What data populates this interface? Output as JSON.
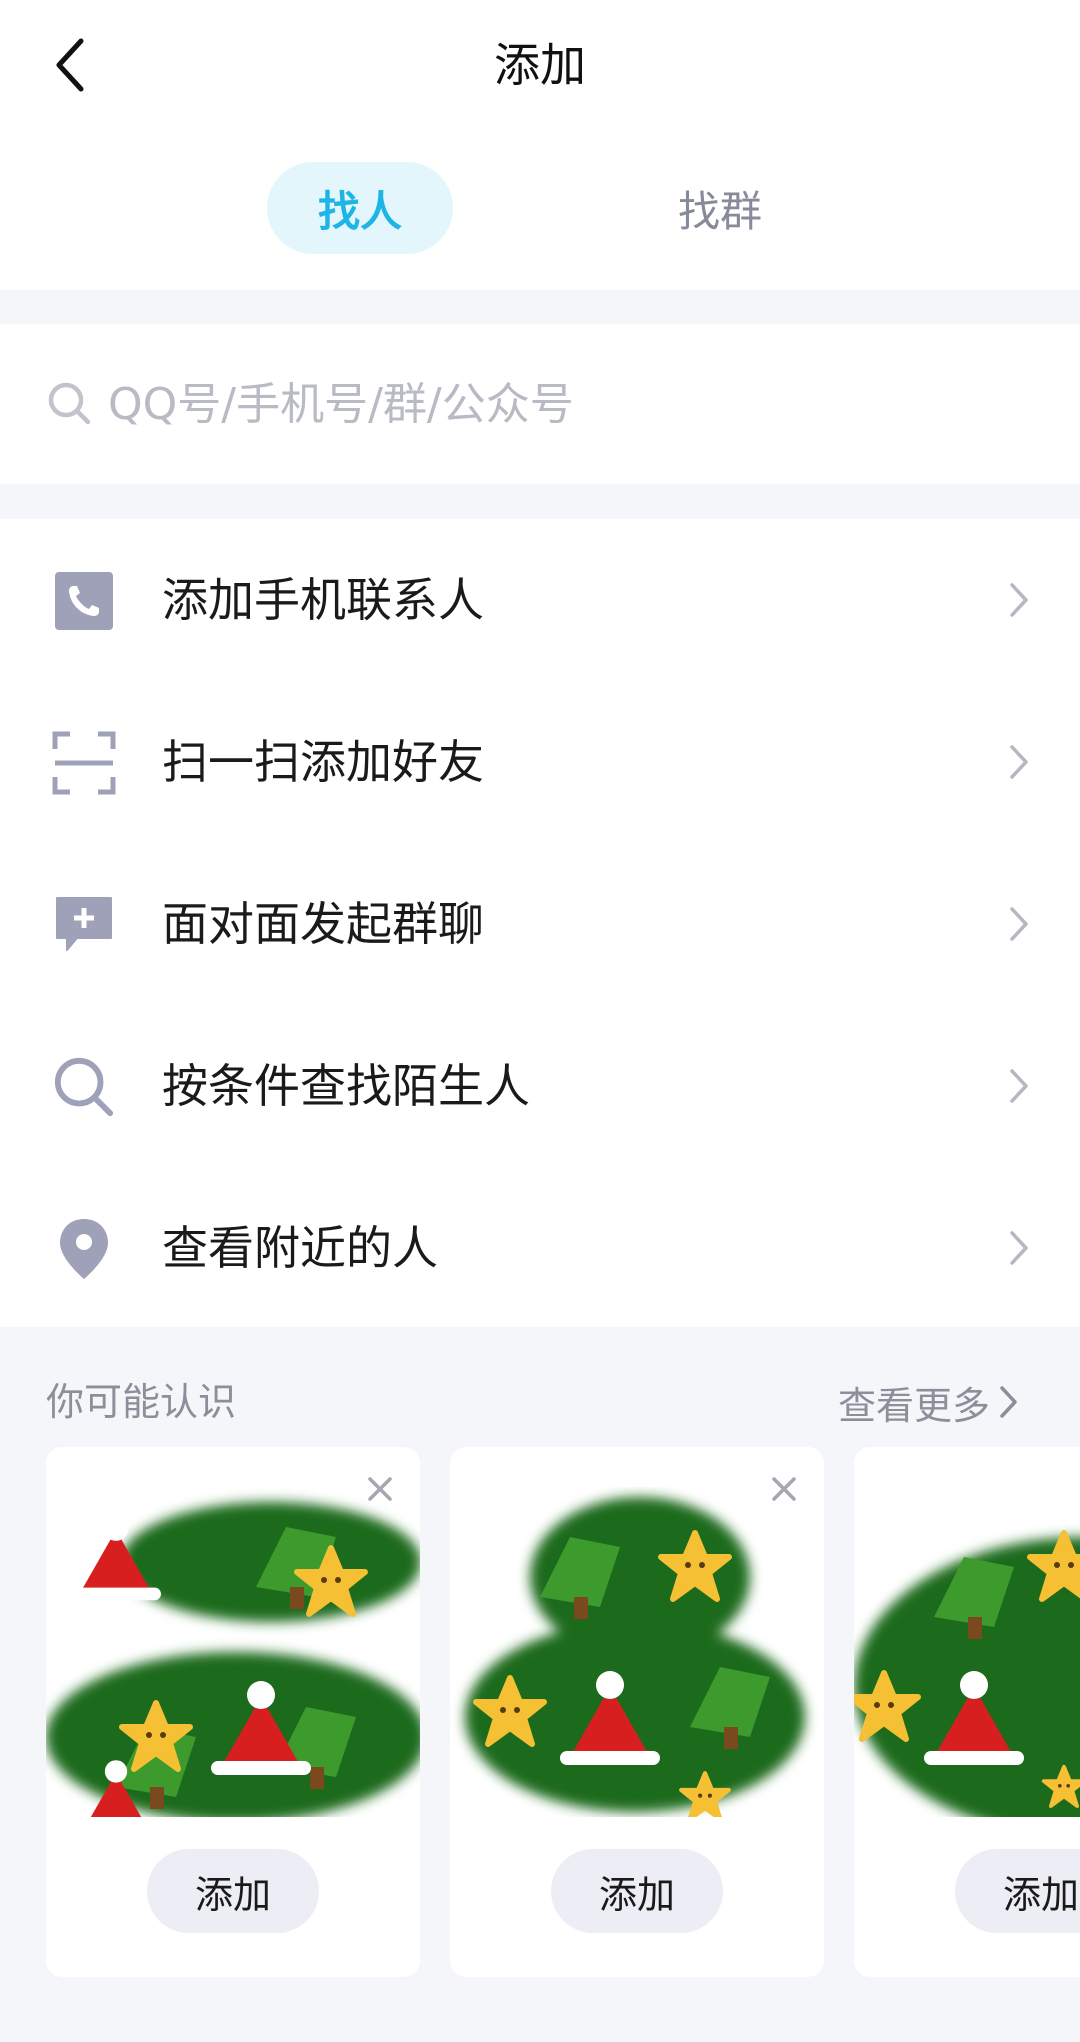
{
  "header": {
    "title": "添加",
    "tabs": [
      {
        "label": "找人",
        "active": true
      },
      {
        "label": "找群",
        "active": false
      }
    ]
  },
  "search": {
    "placeholder": "QQ号/手机号/群/公众号"
  },
  "menu": [
    {
      "icon": "phone-contacts-icon",
      "label": "添加手机联系人"
    },
    {
      "icon": "scan-icon",
      "label": "扫一扫添加好友"
    },
    {
      "icon": "chat-plus-icon",
      "label": "面对面发起群聊"
    },
    {
      "icon": "search-icon",
      "label": "按条件查找陌生人"
    },
    {
      "icon": "location-pin-icon",
      "label": "查看附近的人"
    }
  ],
  "suggestions": {
    "title": "你可能认识",
    "see_more": "查看更多",
    "cards": [
      {
        "add_label": "添加"
      },
      {
        "add_label": "添加"
      },
      {
        "add_label": "添加"
      }
    ]
  },
  "colors": {
    "accent": "#1fb4e6",
    "accent_bg": "#e3f6fc",
    "icon_gray": "#9ea1b8",
    "background": "#f5f6fa"
  }
}
